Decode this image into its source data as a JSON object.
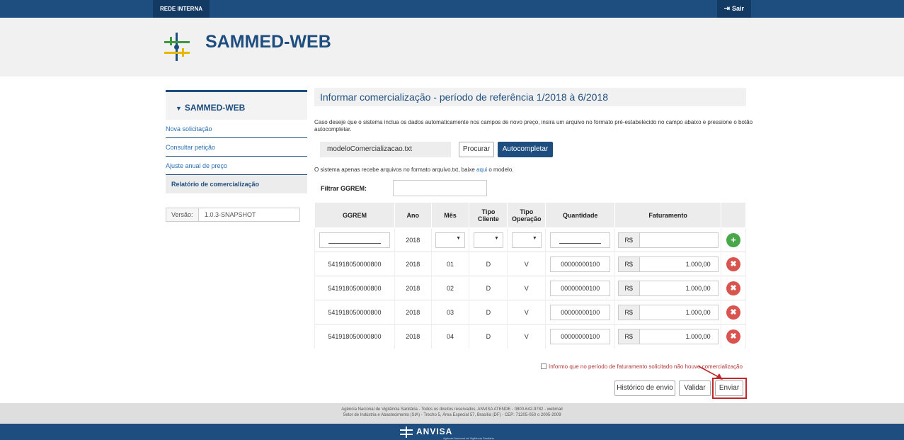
{
  "topbar": {
    "rede_interna": "REDE INTERNA",
    "sair": "Sair"
  },
  "brand": {
    "name": "SAMMED-WEB"
  },
  "sidebar": {
    "title": "SAMMED-WEB",
    "items": [
      {
        "label": "Nova solicitação"
      },
      {
        "label": "Consultar petição"
      },
      {
        "label": "Ajuste anual de preço"
      },
      {
        "label": "Relatório de comercialização"
      }
    ]
  },
  "version": {
    "label": "Versão:",
    "value": "1.0.3-SNAPSHOT"
  },
  "main": {
    "title": "Informar comercialização - período de referência 1/2018 à 6/2018",
    "description": "Caso deseje que o sistema inclua os dados automaticamente nos campos de novo preço, insira um arquivo no formato pré-estabelecido no campo abaixo e pressione o botão autocompletar.",
    "file_name": "modeloComercializacao.txt",
    "procurar_label": "Procurar",
    "autocompletar_label": "Autocompletar",
    "note_before": "O sistema apenas recebe arquivos no formato arquivo.txt, baixe ",
    "note_link": "aqui",
    "note_after": " o modelo.",
    "filter_label": "Filtrar GGREM:"
  },
  "table": {
    "headers": [
      "GGREM",
      "Ano",
      "Mês",
      "Tipo Cliente",
      "Tipo Operação",
      "Quantidade",
      "Faturamento"
    ],
    "new_row": {
      "ano": "2018",
      "currency": "R$"
    },
    "rows": [
      {
        "ggrem": "541918050000800",
        "ano": "2018",
        "mes": "01",
        "tipo_cliente": "D",
        "tipo_operacao": "V",
        "quantidade": "00000000100",
        "currency": "R$",
        "faturamento": "1.000,00"
      },
      {
        "ggrem": "541918050000800",
        "ano": "2018",
        "mes": "02",
        "tipo_cliente": "D",
        "tipo_operacao": "V",
        "quantidade": "00000000100",
        "currency": "R$",
        "faturamento": "1.000,00"
      },
      {
        "ggrem": "541918050000800",
        "ano": "2018",
        "mes": "03",
        "tipo_cliente": "D",
        "tipo_operacao": "V",
        "quantidade": "00000000100",
        "currency": "R$",
        "faturamento": "1.000,00"
      },
      {
        "ggrem": "541918050000800",
        "ano": "2018",
        "mes": "04",
        "tipo_cliente": "D",
        "tipo_operacao": "V",
        "quantidade": "00000000100",
        "currency": "R$",
        "faturamento": "1.000,00"
      }
    ]
  },
  "actions": {
    "declare": "Informo que no período de faturamento solicitado não houve comercialização",
    "historico": "Histórico de envio",
    "validar": "Validar",
    "enviar": "Enviar"
  },
  "footer": {
    "line1": "Agência Nacional de Vigilância Sanitária - Todos os direitos reservados. ANVISA ATENDE - 0800-642-9782 - webmail",
    "line2": "Setor de Indústria e Abastecimento (SIA) - Trecho 5, Área Especial 57, Brasília (DF) - CEP: 71205-050 o 2005-2009",
    "logo": "ANVISA",
    "logo_sub": "Agência Nacional de Vigilância Sanitária"
  },
  "colors": {
    "primary": "#1e4e7f",
    "add": "#48a748",
    "delete": "#d9534f",
    "highlight": "#c0292b"
  }
}
